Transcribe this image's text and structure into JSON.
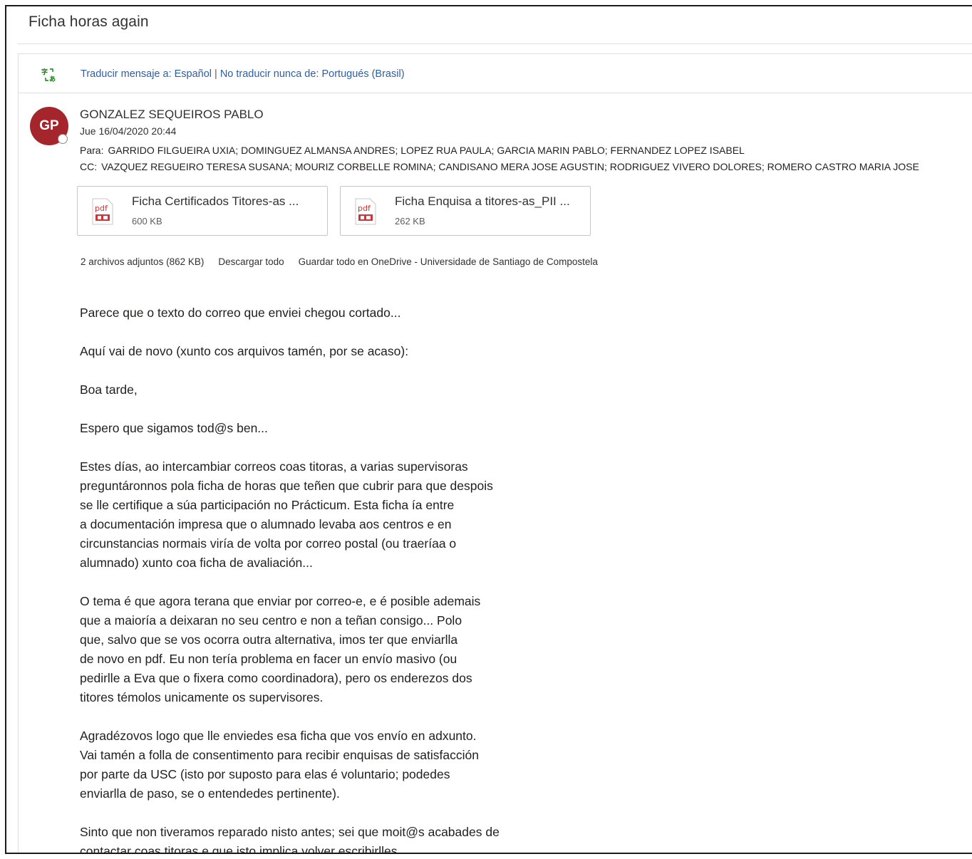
{
  "subject": "Ficha horas again",
  "translate": {
    "icon": "translate-icon",
    "translate_link": "Traducir mensaje a: Español",
    "separator": "|",
    "never_link": "No traducir nunca de: Portugués (Brasil)"
  },
  "sender": {
    "initials": "GP",
    "avatar_color": "#a4262c",
    "name": "GONZALEZ SEQUEIROS PABLO",
    "date": "Jue 16/04/2020 20:44"
  },
  "recipients": {
    "to_label": "Para:",
    "to": "GARRIDO FILGUEIRA UXIA; DOMINGUEZ ALMANSA ANDRES; LOPEZ RUA PAULA; GARCIA MARIN PABLO; FERNANDEZ LOPEZ ISABEL",
    "cc_label": "CC:",
    "cc": "VAZQUEZ REGUEIRO TERESA SUSANA; MOURIZ CORBELLE ROMINA; CANDISANO MERA JOSE AGUSTIN; RODRIGUEZ VIVERO DOLORES; ROMERO CASTRO MARIA JOSE"
  },
  "attachments": [
    {
      "name": "Ficha Certificados Titores-as ...",
      "size": "600 KB",
      "icon": "pdf-icon"
    },
    {
      "name": "Ficha Enquisa a titores-as_PII ...",
      "size": "262 KB",
      "icon": "pdf-icon"
    }
  ],
  "attachment_actions": {
    "summary": "2 archivos adjuntos (862 KB)",
    "download_all": "Descargar todo",
    "save_all": "Guardar todo en OneDrive - Universidade de Santiago de Compostela"
  },
  "body": [
    [
      "Parece que o texto do correo que enviei chegou cortado..."
    ],
    [
      "Aquí vai de novo (xunto cos arquivos tamén, por se acaso):"
    ],
    [
      "Boa tarde,"
    ],
    [
      "Espero que sigamos tod@s ben..."
    ],
    [
      "Estes días, ao intercambiar correos coas titoras, a varias supervisoras",
      "preguntáronnos pola ficha de horas que teñen que cubrir para que despois",
      "se lle certifique a súa participación no Prácticum. Esta ficha ía entre",
      "a documentación impresa que o alumnado levaba aos centros e en",
      "circunstancias normais viría de volta por correo postal (ou traeríaa o",
      "alumnado) xunto coa ficha de avaliación..."
    ],
    [
      "O tema é que agora terana que enviar por correo-e, e é posible ademais",
      "que a maioría a deixaran no seu centro e non a teñan consigo... Polo",
      "que, salvo que se vos ocorra outra alternativa, imos ter que enviarlla",
      "de novo en pdf. Eu non tería problema en facer un envío masivo (ou",
      "pedirlle a Eva que o fixera como coordinadora), pero os enderezos dos",
      "titores témolos unicamente os supervisores."
    ],
    [
      "Agradézovos logo que lle enviedes esa ficha que vos envío en adxunto.",
      "Vai tamén a folla de consentimento para recibir enquisas de satisfacción",
      "por parte da USC (isto por suposto para elas é voluntario; podedes",
      "enviarlla de paso, se o entendedes pertinente)."
    ],
    [
      "Sinto que non tiveramos reparado nisto antes; sei que moit@s acabades de",
      "contactar coas titoras e que isto implica volver escribirlles..."
    ]
  ]
}
